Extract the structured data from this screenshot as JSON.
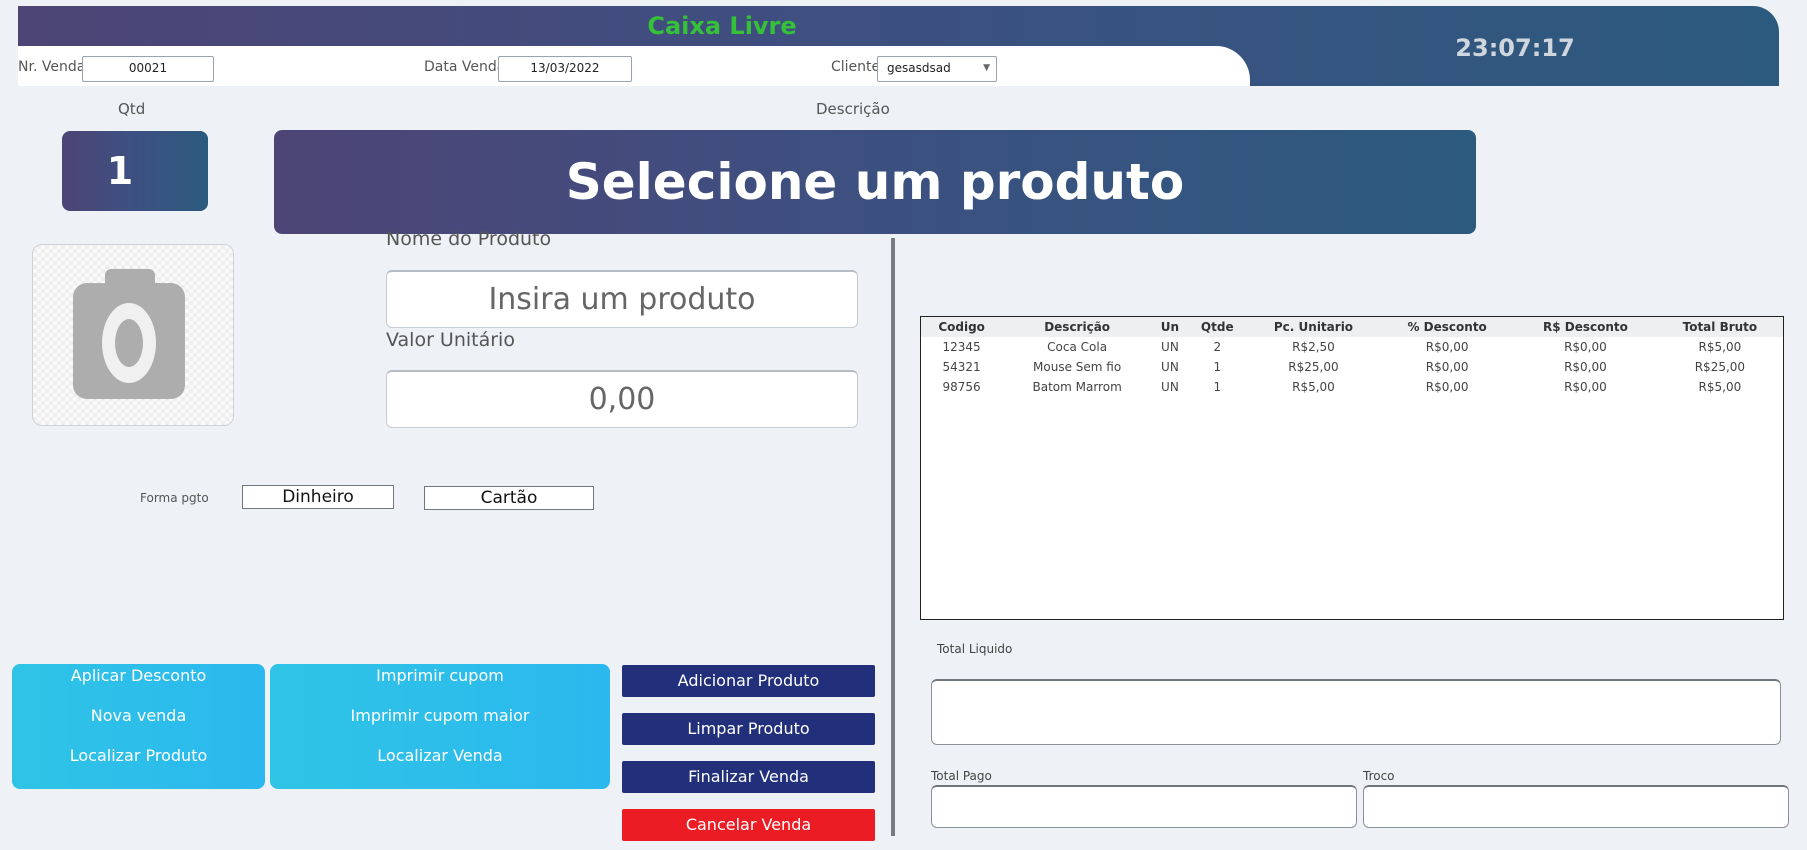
{
  "header": {
    "title": "Caixa Livre",
    "clock": "23:07:17",
    "nr_venda_label": "Nr. Venda:",
    "nr_venda_value": "00021",
    "data_venda_label": "Data Venda:",
    "data_venda_value": "13/03/2022",
    "cliente_label": "Cliente:",
    "cliente_value": "gesasdsad"
  },
  "product": {
    "qtd_label": "Qtd",
    "qtd_value": "1",
    "descricao_label": "Descrição",
    "descricao_banner": "Selecione um produto",
    "nome_label": "Nome do Produto",
    "nome_value": "Insira um produto",
    "valor_label": "Valor Unitário",
    "valor_value": "0,00",
    "photo_icon": "camera-icon"
  },
  "payment": {
    "label": "Forma pgto",
    "options": [
      "Dinheiro",
      "Cartão"
    ]
  },
  "menu_left": [
    "Aplicar Desconto",
    "Nova venda",
    "Localizar Produto"
  ],
  "menu_right": [
    "Imprimir cupom",
    "Imprimir cupom maior",
    "Localizar Venda"
  ],
  "actions": {
    "add": "Adicionar Produto",
    "clear": "Limpar Produto",
    "finish": "Finalizar Venda",
    "cancel": "Cancelar Venda"
  },
  "table": {
    "columns": [
      "Codigo",
      "Descrição",
      "Un",
      "Qtde",
      "Pc. Unitario",
      "% Desconto",
      "R$ Desconto",
      "Total Bruto"
    ],
    "rows": [
      [
        "12345",
        "Coca Cola",
        "UN",
        "2",
        "R$2,50",
        "R$0,00",
        "R$0,00",
        "R$5,00"
      ],
      [
        "54321",
        "Mouse Sem fio",
        "UN",
        "1",
        "R$25,00",
        "R$0,00",
        "R$0,00",
        "R$25,00"
      ],
      [
        "98756",
        "Batom Marrom",
        "UN",
        "1",
        "R$5,00",
        "R$0,00",
        "R$0,00",
        "R$5,00"
      ]
    ]
  },
  "totals": {
    "liquido_label": "Total Liquido",
    "pago_label": "Total Pago",
    "troco_label": "Troco"
  },
  "colors": {
    "title_green": "#36c238",
    "navy": "#222f7a",
    "cancel_red": "#ec1c24",
    "menu_cyan": "#2fc4e6"
  }
}
